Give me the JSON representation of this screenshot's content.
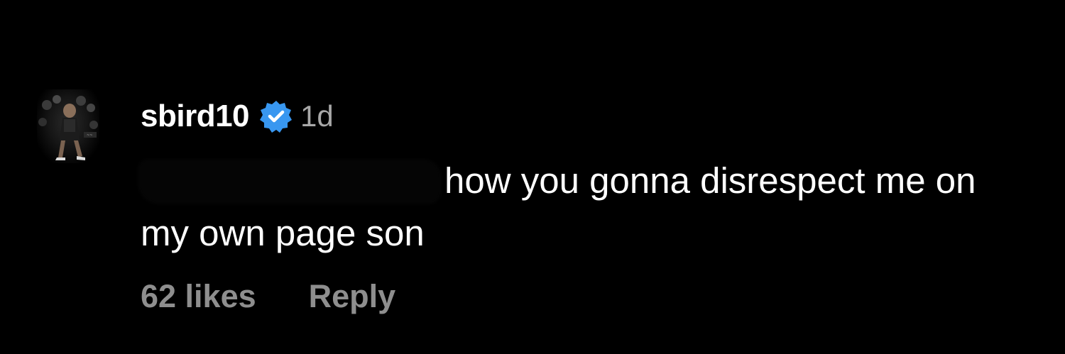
{
  "comment": {
    "username": "sbird10",
    "verified_icon": "verified-badge-icon",
    "verified_color": "#3897f0",
    "timestamp": "1d",
    "text": "how you gonna disrespect me on my own page son",
    "likes_label": "62 likes",
    "reply_label": "Reply",
    "avatar_icon": "profile-avatar"
  },
  "colors": {
    "background": "#000000",
    "text_primary": "#ffffff",
    "text_secondary": "#a8a8a8",
    "action_text": "#8e8e8e"
  }
}
